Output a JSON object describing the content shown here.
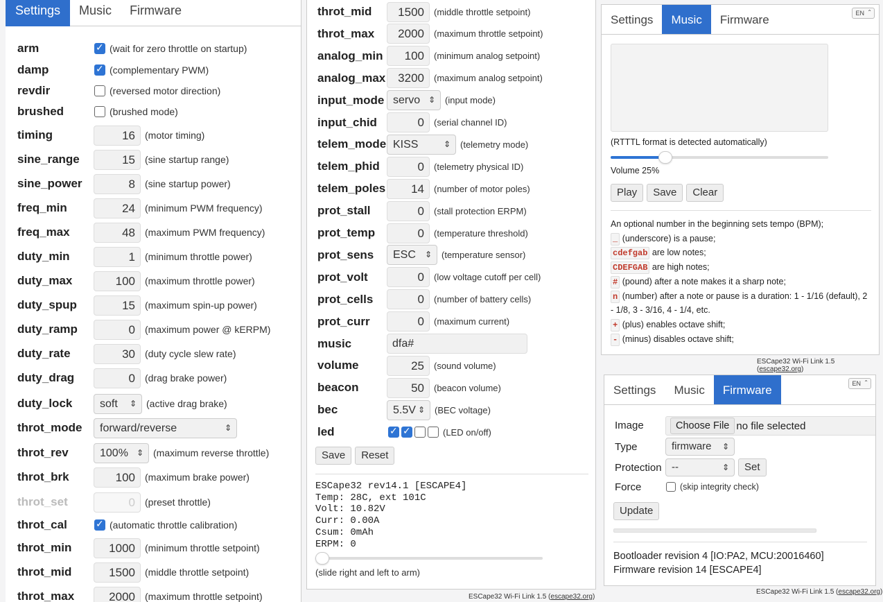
{
  "tabs": {
    "settings": "Settings",
    "music": "Music",
    "firmware": "Firmware"
  },
  "lang": "EN",
  "p1": {
    "rows": [
      {
        "label": "arm",
        "hint": "(wait for zero throttle on startup)"
      },
      {
        "label": "damp",
        "hint": "(complementary PWM)"
      },
      {
        "label": "revdir",
        "hint": "(reversed motor direction)"
      },
      {
        "label": "brushed",
        "hint": "(brushed mode)"
      },
      {
        "label": "timing",
        "value": "16",
        "hint": "(motor timing)"
      },
      {
        "label": "sine_range",
        "value": "15",
        "hint": "(sine startup range)"
      },
      {
        "label": "sine_power",
        "value": "8",
        "hint": "(sine startup power)"
      },
      {
        "label": "freq_min",
        "value": "24",
        "hint": "(minimum PWM frequency)"
      },
      {
        "label": "freq_max",
        "value": "48",
        "hint": "(maximum PWM frequency)"
      },
      {
        "label": "duty_min",
        "value": "1",
        "hint": "(minimum throttle power)"
      },
      {
        "label": "duty_max",
        "value": "100",
        "hint": "(maximum throttle power)"
      },
      {
        "label": "duty_spup",
        "value": "15",
        "hint": "(maximum spin-up power)"
      },
      {
        "label": "duty_ramp",
        "value": "0",
        "hint": "(maximum power @ kERPM)"
      },
      {
        "label": "duty_rate",
        "value": "30",
        "hint": "(duty cycle slew rate)"
      },
      {
        "label": "duty_drag",
        "value": "0",
        "hint": "(drag brake power)"
      },
      {
        "label": "duty_lock",
        "value": "soft",
        "hint": "(active drag brake)"
      },
      {
        "label": "throt_mode",
        "value": "forward/reverse"
      },
      {
        "label": "throt_rev",
        "value": "100%",
        "hint": "(maximum reverse throttle)"
      },
      {
        "label": "throt_brk",
        "value": "100",
        "hint": "(maximum brake power)"
      },
      {
        "label": "throt_set",
        "value": "0",
        "hint": "(preset throttle)"
      },
      {
        "label": "throt_cal",
        "hint": "(automatic throttle calibration)"
      },
      {
        "label": "throt_min",
        "value": "1000",
        "hint": "(minimum throttle setpoint)"
      },
      {
        "label": "throt_mid",
        "value": "1500",
        "hint": "(middle throttle setpoint)"
      },
      {
        "label": "throt_max",
        "value": "2000",
        "hint": "(maximum throttle setpoint)"
      }
    ],
    "checks": {
      "arm": true,
      "damp": true,
      "revdir": false,
      "brushed": false,
      "throt_cal": true
    }
  },
  "p2": {
    "rows": [
      {
        "label": "throt_mid",
        "value": "1500",
        "hint": "(middle throttle setpoint)"
      },
      {
        "label": "throt_max",
        "value": "2000",
        "hint": "(maximum throttle setpoint)"
      },
      {
        "label": "analog_min",
        "value": "100",
        "hint": "(minimum analog setpoint)"
      },
      {
        "label": "analog_max",
        "value": "3200",
        "hint": "(maximum analog setpoint)"
      },
      {
        "label": "input_mode",
        "value": "servo",
        "hint": "(input mode)"
      },
      {
        "label": "input_chid",
        "value": "0",
        "hint": "(serial channel ID)"
      },
      {
        "label": "telem_mode",
        "value": "KISS",
        "hint": "(telemetry mode)"
      },
      {
        "label": "telem_phid",
        "value": "0",
        "hint": "(telemetry physical ID)"
      },
      {
        "label": "telem_poles",
        "value": "14",
        "hint": "(number of motor poles)"
      },
      {
        "label": "prot_stall",
        "value": "0",
        "hint": "(stall protection ERPM)"
      },
      {
        "label": "prot_temp",
        "value": "0",
        "hint": "(temperature threshold)"
      },
      {
        "label": "prot_sens",
        "value": "ESC",
        "hint": "(temperature sensor)"
      },
      {
        "label": "prot_volt",
        "value": "0",
        "hint": "(low voltage cutoff per cell)"
      },
      {
        "label": "prot_cells",
        "value": "0",
        "hint": "(number of battery cells)"
      },
      {
        "label": "prot_curr",
        "value": "0",
        "hint": "(maximum current)"
      },
      {
        "label": "music",
        "value": "dfa#"
      },
      {
        "label": "volume",
        "value": "25",
        "hint": "(sound volume)"
      },
      {
        "label": "beacon",
        "value": "50",
        "hint": "(beacon volume)"
      },
      {
        "label": "bec",
        "value": "5.5V",
        "hint": "(BEC voltage)"
      },
      {
        "label": "led",
        "hint": "(LED on/off)"
      }
    ],
    "led_states": [
      true,
      true,
      false,
      false
    ],
    "save": "Save",
    "reset": "Reset",
    "status": "ESCape32 rev14.1 [ESCAPE4]\nTemp: 28C, ext 101C\nVolt: 10.82V\nCurr: 0.00A\nCsum: 0mAh\nERPM: 0",
    "arm_level": 0.03,
    "arm_hint": "(slide right and left to arm)",
    "footer_prefix": "ESCape32 Wi-Fi Link 1.5 (",
    "footer_link": "escape32.org",
    "footer_suffix": ")"
  },
  "p3": {
    "rtttl_note": "(RTTTL format is detected automatically)",
    "volume_level": 0.25,
    "volume_label": "Volume 25%",
    "play": "Play",
    "save": "Save",
    "clear": "Clear",
    "help": {
      "intro": "An optional number in the beginning sets tempo (BPM);",
      "k1": "_",
      "t1": "(underscore) is a pause;",
      "k2": "cdefgab",
      "t2": "are low notes;",
      "k3": "CDEFGAB",
      "t3": "are high notes;",
      "k4": "#",
      "t4": "(pound) after a note makes it a sharp note;",
      "k5": "n",
      "t5a": "(number) after a note or pause is a duration: 1 - 1/16 (default), 2",
      "t5b": "- 1/8, 3 - 3/16, 4 - 1/4, etc.",
      "k6": "+",
      "t6": "(plus) enables octave shift;",
      "k7": "-",
      "t7": "(minus) disables octave shift;"
    }
  },
  "p4": {
    "image_label": "Image",
    "choose_file": "Choose File",
    "no_file": "no file selected",
    "type_label": "Type",
    "type_value": "firmware",
    "protection_label": "Protection",
    "protection_value": "--",
    "set": "Set",
    "force_label": "Force",
    "force_hint": "(skip integrity check)",
    "update": "Update",
    "bootloader": "Bootloader revision 4 [IO:PA2, MCU:20016460]",
    "firmware": "Firmware revision 14 [ESCAPE4]"
  }
}
